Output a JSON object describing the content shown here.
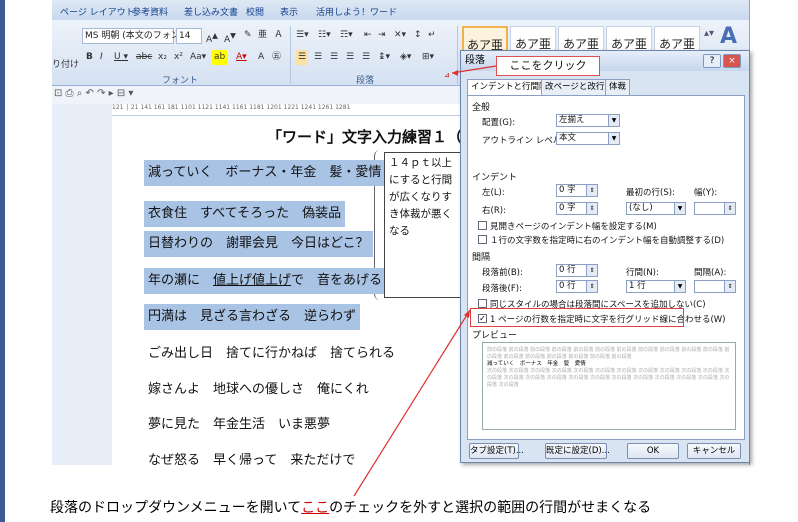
{
  "ribbon_tabs": [
    "ページ レイアウト",
    "参考資料",
    "差し込み文書",
    "校閲",
    "表示",
    "活用しよう！ワード"
  ],
  "font": {
    "name": "MS 明朝 (本文のフォン",
    "size": "14",
    "group_label": "フォント",
    "left_cut_label": "り付け"
  },
  "paragraph_group_label": "段落",
  "styles": [
    "あア亜",
    "あア亜",
    "あア亜",
    "あア亜",
    "あア亜"
  ],
  "ruler_text": "121 │ 21 141 161 181 1101 1121 1141 1161 1181 1201 1221 1241 1261 1281",
  "document": {
    "title": "「ワード」文字入力練習１（",
    "lines": [
      "減っていく　ボーナス・年金　髪・愛情",
      "衣食住　すべてそろった　偽装品",
      "日替わりの　謝罪会見　今日はどこ？",
      "年の瀬に　値上げ値上げで　音をあげる",
      "円満は　見ざる言わざる　逆らわず",
      "ごみ出し日　捨てに行かねば　捨てられる",
      "嫁さんよ　地球への優しさ　俺にくれ",
      "夢に見た　年金生活　いま悪夢",
      "なぜ怒る　早く帰って　来ただけで"
    ],
    "underlined_fragment": "値上げ値上げ",
    "comment": "１４ｐｔ以上にすると行間が広くなりすき体裁が悪くなる"
  },
  "dialog": {
    "title": "段落",
    "callout": "ここをクリック",
    "help": "?",
    "close": "×",
    "tabs": [
      "インデントと行間隔",
      "改ページと改行",
      "体裁"
    ],
    "general": {
      "heading": "全般",
      "alignment_label": "配置(G):",
      "alignment_value": "左揃え",
      "outline_label": "アウトライン レベル(O):",
      "outline_value": "本文"
    },
    "indent": {
      "heading": "インデント",
      "left_label": "左(L):",
      "left_value": "0 字",
      "right_label": "右(R):",
      "right_value": "0 字",
      "first_line_label": "最初の行(S):",
      "first_line_value": "(なし)",
      "width_label": "幅(Y):",
      "mirror_label": "見開きページのインデント幅を設定する(M)",
      "auto_adjust_label": "１行の文字数を指定時に右のインデント幅を自動調整する(D)"
    },
    "spacing": {
      "heading": "間隔",
      "before_label": "段落前(B):",
      "before_value": "0 行",
      "after_label": "段落後(F):",
      "after_value": "0 行",
      "line_label": "行間(N):",
      "line_value": "1 行",
      "at_label": "間隔(A):",
      "no_space_label": "同じスタイルの場合は段落間にスペースを追加しない(C)",
      "grid_label": "1 ページの行数を指定時に文字を行グリッド線に合わせる(W)",
      "grid_checked": true
    },
    "preview": {
      "heading": "プレビュー",
      "filler": "前の段落 前の段落 前の段落 前の段落 前の段落 前の段落 前の段落 前の段落 前の段落 前の段落 前の段落 前の段落 前の段落 前の段落 前の段落 前の段落 前の段落 前の段落",
      "sample": "減っていく　ボーナス　年金　髪　愛情",
      "filler_after": "次の段落 次の段落 次の段落 次の段落 次の段落 次の段落 次の段落 次の段落 次の段落 次の段落 次の段落 次の段落 次の段落 次の段落 次の段落 次の段落 次の段落 次の段落 次の段落 次の段落 次の段落 次の段落 次の段落 次の段落"
    },
    "buttons": {
      "tabs": "タブ設定(T)...",
      "default": "既定に設定(D)...",
      "ok": "OK",
      "cancel": "キャンセル"
    }
  },
  "instruction": {
    "before": "段落のドロップダウンメニューを開いて",
    "link": "ここ",
    "after": "のチェックを外すと選択の範囲の行間がせまくなる"
  }
}
